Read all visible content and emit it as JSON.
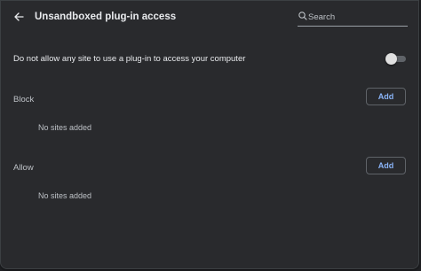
{
  "header": {
    "title": "Unsandboxed plug-in access",
    "back_icon": "arrow-left-icon",
    "search": {
      "placeholder": "Search",
      "value": ""
    }
  },
  "setting": {
    "label": "Do not allow any site to use a plug-in to access your computer",
    "toggle_on": false
  },
  "sections": {
    "block": {
      "title": "Block",
      "add_label": "Add",
      "empty_text": "No sites added"
    },
    "allow": {
      "title": "Allow",
      "add_label": "Add",
      "empty_text": "No sites added"
    }
  },
  "colors": {
    "background": "#202124",
    "panel": "#292a2d",
    "accent": "#8ab4f8",
    "text": "#e8eaed",
    "secondary_text": "#bdc1c6"
  }
}
